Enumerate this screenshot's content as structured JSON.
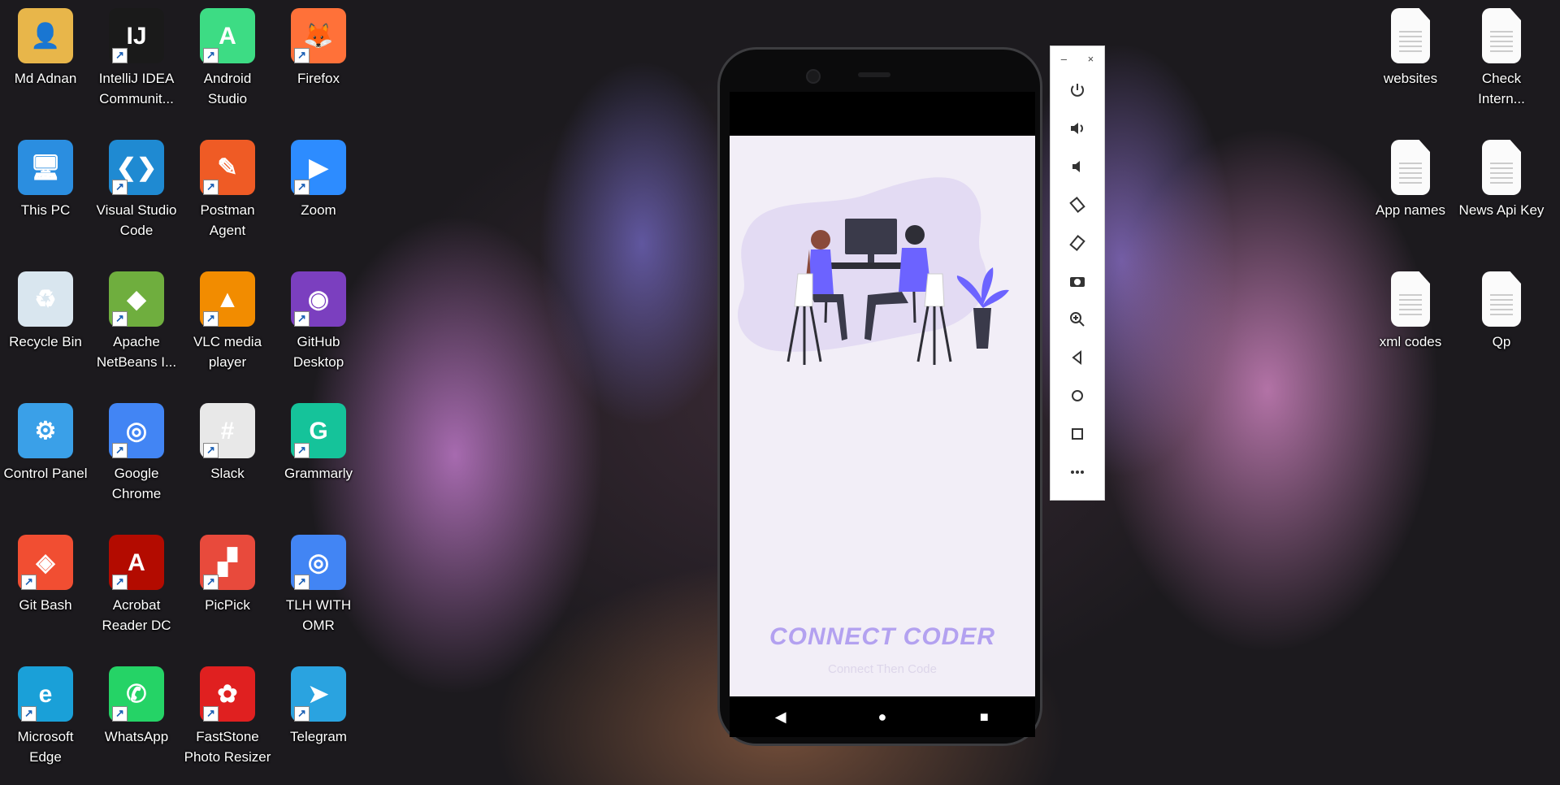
{
  "desktop": {
    "left_icons": [
      {
        "label": "Md Adnan",
        "icon": "user-folder-icon",
        "color": "#e8b64a"
      },
      {
        "label": "IntelliJ IDEA Communit...",
        "icon": "intellij-icon",
        "color": "#1a1a1a"
      },
      {
        "label": "Android Studio",
        "icon": "android-studio-icon",
        "color": "#3ddc84"
      },
      {
        "label": "Firefox",
        "icon": "firefox-icon",
        "color": "#ff7139"
      },
      {
        "label": "This PC",
        "icon": "computer-icon",
        "color": "#2b8ee0"
      },
      {
        "label": "Visual Studio Code",
        "icon": "vscode-icon",
        "color": "#1f8ad2"
      },
      {
        "label": "Postman Agent",
        "icon": "postman-icon",
        "color": "#ef5b25"
      },
      {
        "label": "Zoom",
        "icon": "zoom-icon",
        "color": "#2d8cff"
      },
      {
        "label": "Recycle Bin",
        "icon": "recycle-bin-icon",
        "color": "#d9e6ef"
      },
      {
        "label": "Apache NetBeans I...",
        "icon": "netbeans-icon",
        "color": "#6fae3e"
      },
      {
        "label": "VLC media player",
        "icon": "vlc-icon",
        "color": "#f28c00"
      },
      {
        "label": "GitHub Desktop",
        "icon": "github-icon",
        "color": "#7b3fbf"
      },
      {
        "label": "Control Panel",
        "icon": "control-panel-icon",
        "color": "#3aa0e8"
      },
      {
        "label": "Google Chrome",
        "icon": "chrome-icon",
        "color": "#4285f4"
      },
      {
        "label": "Slack",
        "icon": "slack-icon",
        "color": "#e8e8e8"
      },
      {
        "label": "Grammarly",
        "icon": "grammarly-icon",
        "color": "#15c39a"
      },
      {
        "label": "Git Bash",
        "icon": "git-bash-icon",
        "color": "#f14e32"
      },
      {
        "label": "Acrobat Reader DC",
        "icon": "acrobat-icon",
        "color": "#b30b00"
      },
      {
        "label": "PicPick",
        "icon": "picpick-icon",
        "color": "#e84a3c"
      },
      {
        "label": "TLH WITH OMR",
        "icon": "chrome-icon",
        "color": "#4285f4"
      },
      {
        "label": "Microsoft Edge",
        "icon": "edge-icon",
        "color": "#1aa0d8"
      },
      {
        "label": "WhatsApp",
        "icon": "whatsapp-icon",
        "color": "#25d366"
      },
      {
        "label": "FastStone Photo Resizer",
        "icon": "faststone-icon",
        "color": "#e02020"
      },
      {
        "label": "Telegram",
        "icon": "telegram-icon",
        "color": "#2aa3e0"
      }
    ],
    "right_icons": [
      {
        "label": "websites",
        "icon": "document-icon"
      },
      {
        "label": "Check Intern...",
        "icon": "document-icon"
      },
      {
        "label": "App names",
        "icon": "document-icon"
      },
      {
        "label": "News Api Key",
        "icon": "document-icon"
      },
      {
        "label": "xml codes",
        "icon": "document-icon"
      },
      {
        "label": "Qp",
        "icon": "document-icon"
      }
    ]
  },
  "app": {
    "title": "CONNECT CODER",
    "tagline": "Connect Then Code"
  },
  "emulator_toolbar": {
    "minimize": "–",
    "close": "×",
    "buttons": [
      "power-icon",
      "volume-up-icon",
      "volume-down-icon",
      "rotate-left-icon",
      "rotate-right-icon",
      "camera-icon",
      "zoom-icon",
      "back-icon",
      "home-icon",
      "overview-icon",
      "more-icon"
    ]
  }
}
